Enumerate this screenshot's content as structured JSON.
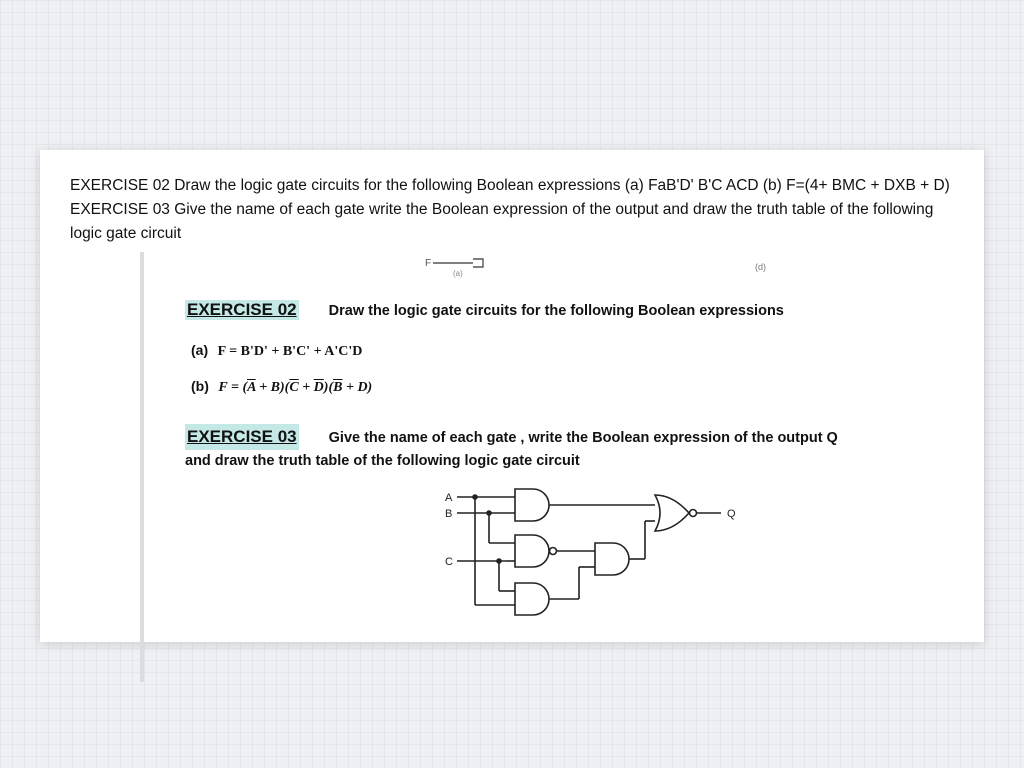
{
  "summary": "EXERCISE 02 Draw the logic gate circuits for the following Boolean expressions (a) FaB'D' B'C ACD (b) F=(4+ BMC + DXB + D) EXERCISE 03 Give the name of each gate write the Boolean expression of the output and draw the truth table of the following logic gate circuit",
  "topfig": {
    "f_label": "F",
    "sub_a": "(a)",
    "sub_b": "(d)"
  },
  "ex02": {
    "heading": "EXERCISE 02",
    "instruction": "Draw the logic gate circuits for the following Boolean expressions",
    "item_a_label": "(a)",
    "item_a_expr": "F = B'D' + B'C' + A'C'D",
    "item_b_label": "(b)",
    "item_b_prefix": "F = (",
    "item_b_A": "A",
    "item_b_plus1": " + B)(",
    "item_b_C": "C",
    "item_b_plus2": " + ",
    "item_b_D": "D",
    "item_b_mid": ")(",
    "item_b_B": "B",
    "item_b_plus3": " + D)"
  },
  "ex03": {
    "heading": "EXERCISE 03",
    "text_part1": "Give the name of each gate , write the Boolean expression of the output Q",
    "text_part2": "and draw the truth table of the following logic gate circuit",
    "labels": {
      "A": "A",
      "B": "B",
      "C": "C",
      "Q": "Q"
    }
  }
}
